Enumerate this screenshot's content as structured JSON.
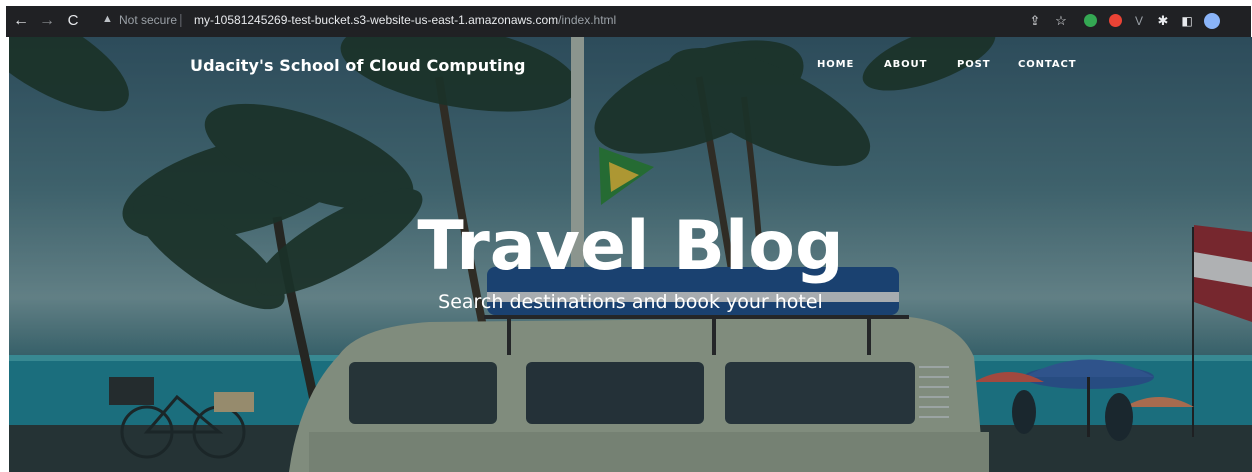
{
  "browser": {
    "security_label": "Not secure",
    "url_host": "my-10581245269-test-bucket.s3-website-us-east-1.amazonaws.com",
    "url_path": "/index.html"
  },
  "site": {
    "brand": "Udacity's School of Cloud Computing",
    "nav": [
      "HOME",
      "ABOUT",
      "POST",
      "CONTACT"
    ],
    "hero_title": "Travel Blog",
    "hero_subtitle": "Search destinations and book your hotel"
  },
  "colors": {
    "chrome_bg": "#202124",
    "hero_text": "#ffffff",
    "extension_green": "#34a853",
    "extension_red": "#ea4335"
  }
}
